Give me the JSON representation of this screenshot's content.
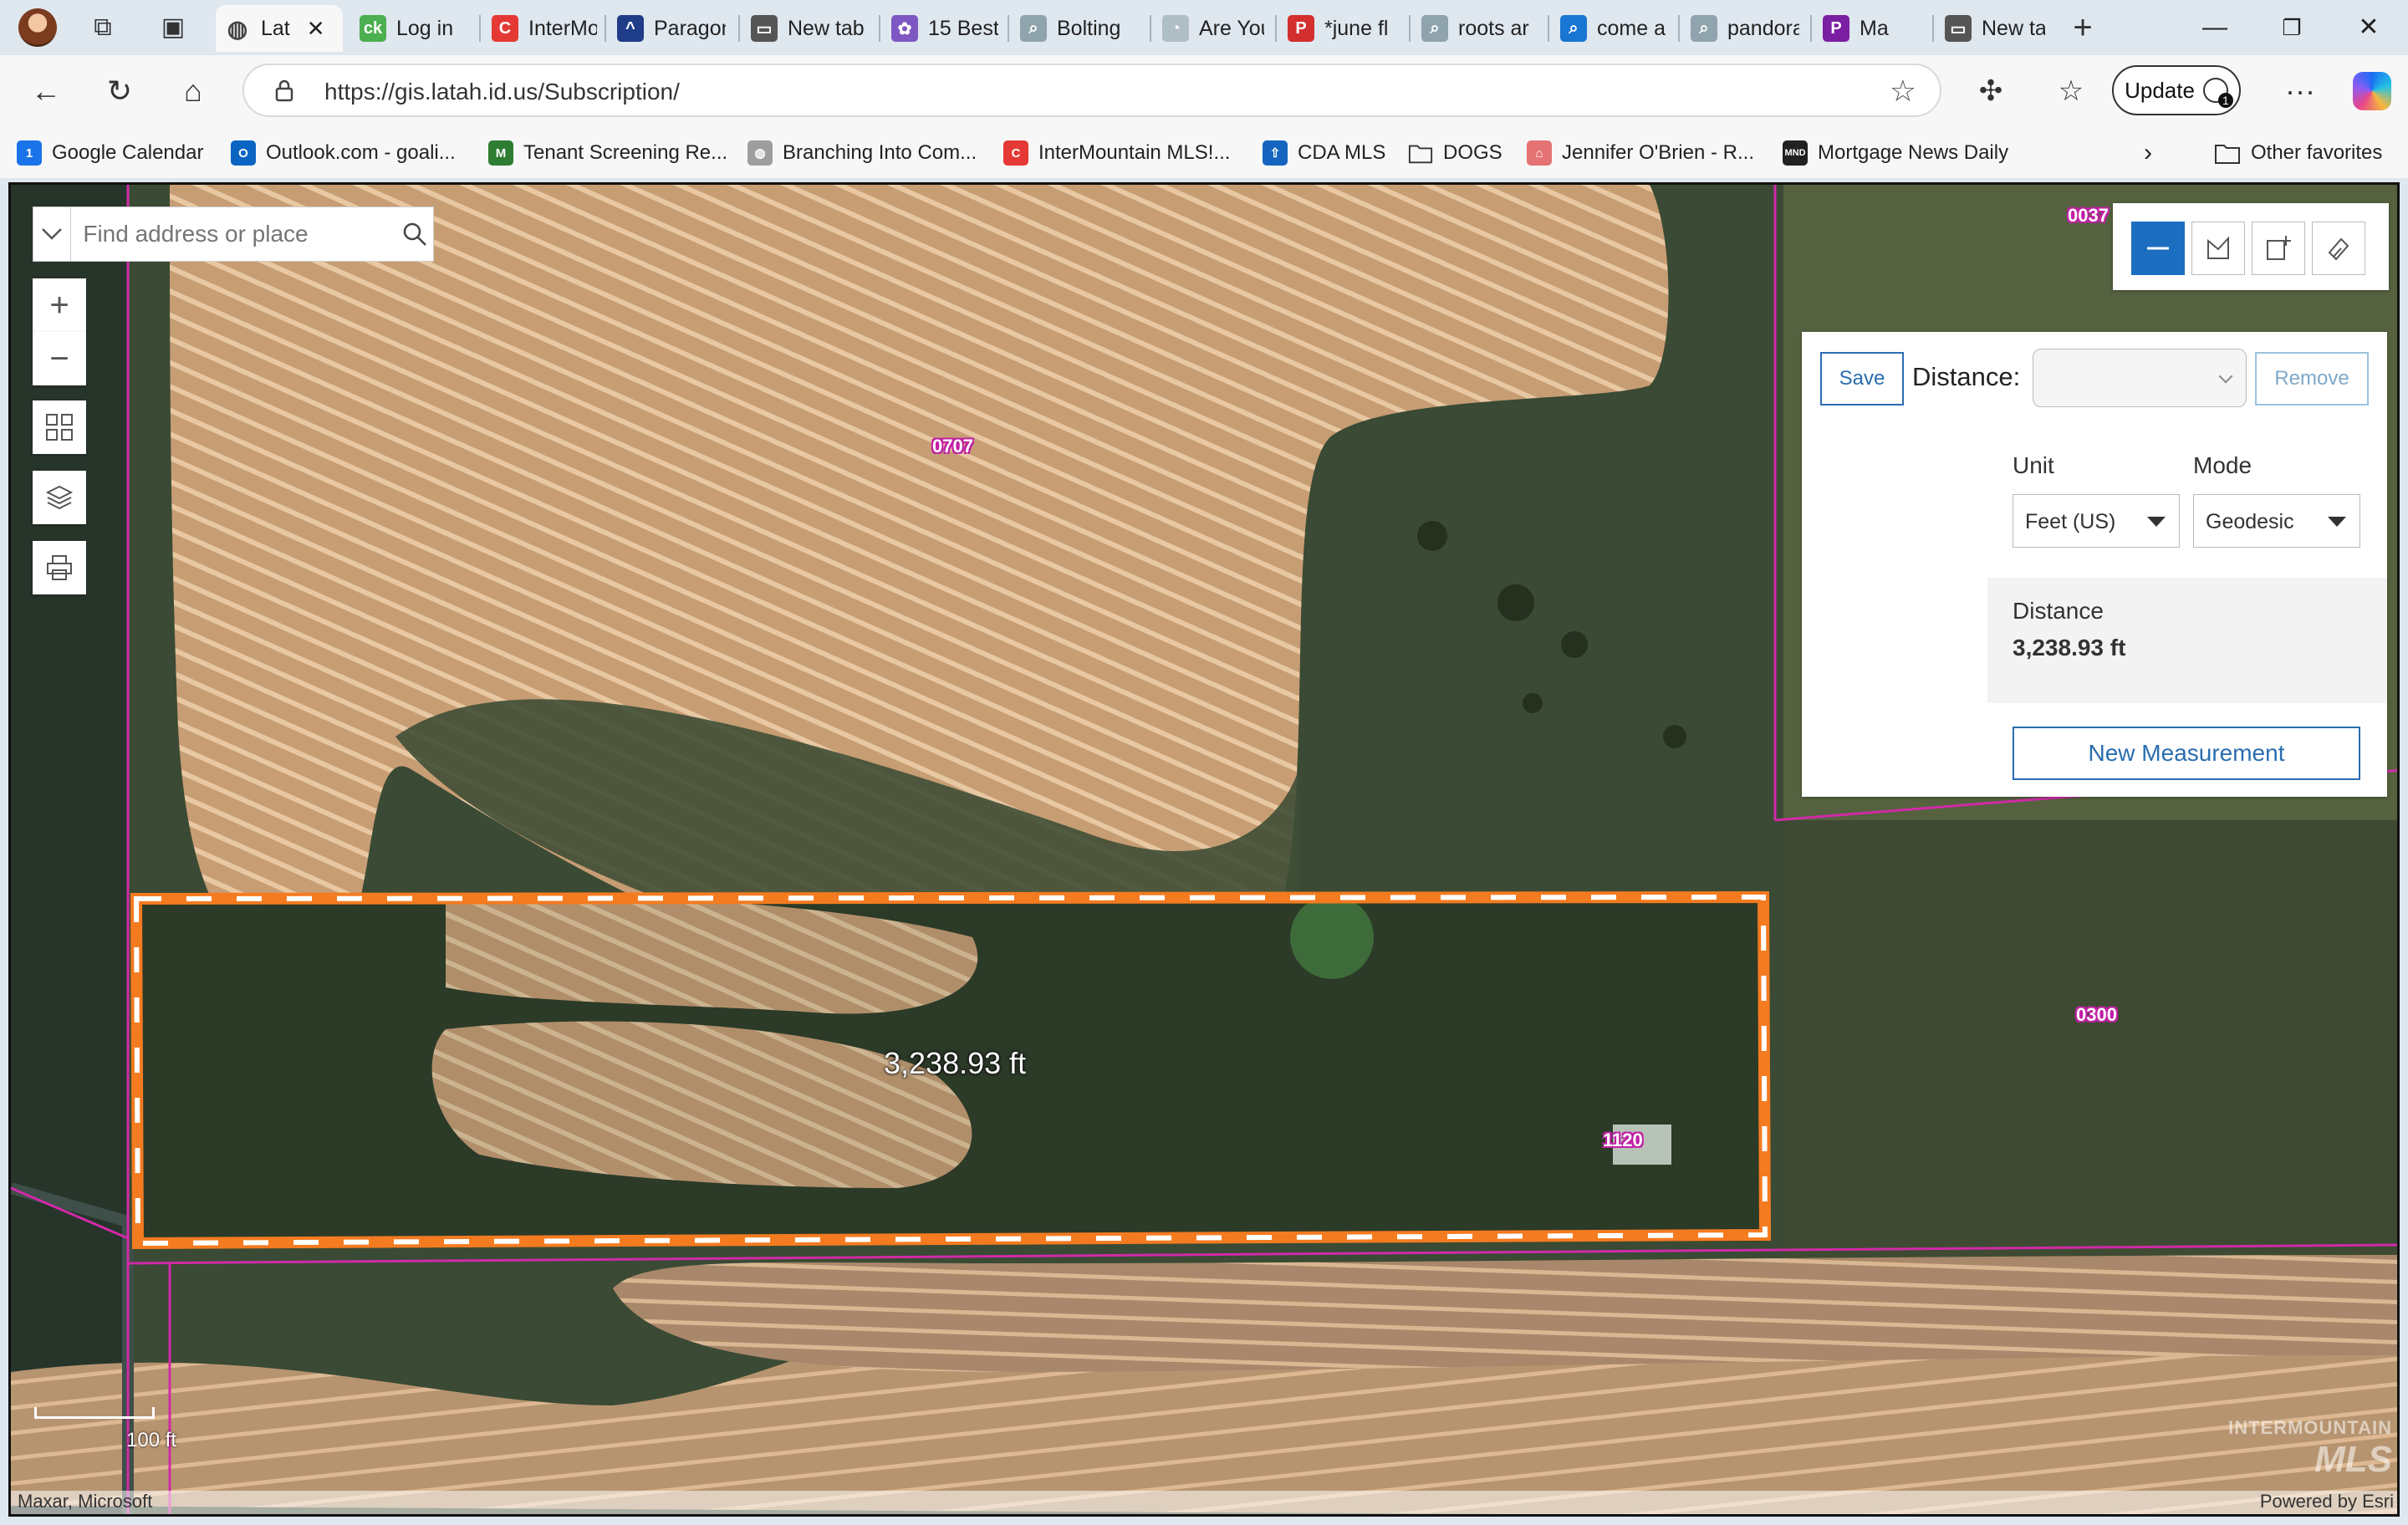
{
  "browser": {
    "tabs": [
      {
        "title": "Lat",
        "color": "#ffffff"
      },
      {
        "title": "Log in",
        "color": "#4caf50",
        "glyph": "ck"
      },
      {
        "title": "InterMo",
        "color": "#e53935",
        "glyph": "C"
      },
      {
        "title": "Paragon",
        "color": "#1f3c88",
        "glyph": "^"
      },
      {
        "title": "New tab",
        "color": "#555555",
        "glyph": "▭"
      },
      {
        "title": "15 Best",
        "color": "#7e57c2",
        "glyph": "✿"
      },
      {
        "title": "Bolting",
        "color": "#90a4ae",
        "glyph": "⌕"
      },
      {
        "title": "Are You",
        "color": "#b0bec5",
        "glyph": "◔"
      },
      {
        "title": "*june fl",
        "color": "#d32f2f",
        "glyph": "P"
      },
      {
        "title": "roots ar",
        "color": "#90a4ae",
        "glyph": "⌕"
      },
      {
        "title": "come a",
        "color": "#1976d2",
        "glyph": "⌕"
      },
      {
        "title": "pandora",
        "color": "#90a4ae",
        "glyph": "⌕"
      },
      {
        "title": "Ma",
        "color": "#7b1fa2",
        "glyph": "P"
      },
      {
        "title": "New tab",
        "color": "#555555",
        "glyph": "▭"
      }
    ],
    "url": "https://gis.latah.id.us/Subscription/",
    "update_label": "Update",
    "favorites": [
      {
        "label": "Google Calendar",
        "color": "#1a73e8",
        "glyph": "1"
      },
      {
        "label": "Outlook.com - goali...",
        "color": "#0a64c2",
        "glyph": "O"
      },
      {
        "label": "Tenant Screening Re...",
        "color": "#2e7d32",
        "glyph": "M"
      },
      {
        "label": "Branching Into Com...",
        "color": "#9e9e9e",
        "glyph": "◍"
      },
      {
        "label": "InterMountain MLS!...",
        "color": "#e53935",
        "glyph": "C"
      },
      {
        "label": "CDA MLS",
        "color": "#1565c0",
        "glyph": "⇧"
      },
      {
        "label": "DOGS",
        "color": "transparent",
        "glyph": "folder"
      },
      {
        "label": "Jennifer O'Brien - R...",
        "color": "#e57373",
        "glyph": "⌂"
      },
      {
        "label": "Mortgage News Daily",
        "color": "#212121",
        "glyph": "MND"
      }
    ],
    "other_favorites_label": "Other favorites"
  },
  "map": {
    "search_placeholder": "Find address or place",
    "parcels": [
      "0707",
      "0037",
      "0300",
      "1120"
    ],
    "measurement_label": "3,238.93 ft",
    "scale_label": "100 ft",
    "attribution_left": "Maxar, Microsoft",
    "attribution_right": "Powered by Esri",
    "watermark_line1": "INTERMOUNTAIN",
    "watermark_line2": "MLS"
  },
  "measure": {
    "save_label": "Save",
    "distance_label": "Distance:",
    "remove_label": "Remove",
    "unit_header": "Unit",
    "mode_header": "Mode",
    "unit_value": "Feet (US)",
    "mode_value": "Geodesic",
    "result_label": "Distance",
    "result_value": "3,238.93 ft",
    "new_label": "New Measurement"
  },
  "colors": {
    "accent": "#1c6fc0",
    "parcel_line": "#d12aa8",
    "measure_line": "#f47b20"
  }
}
